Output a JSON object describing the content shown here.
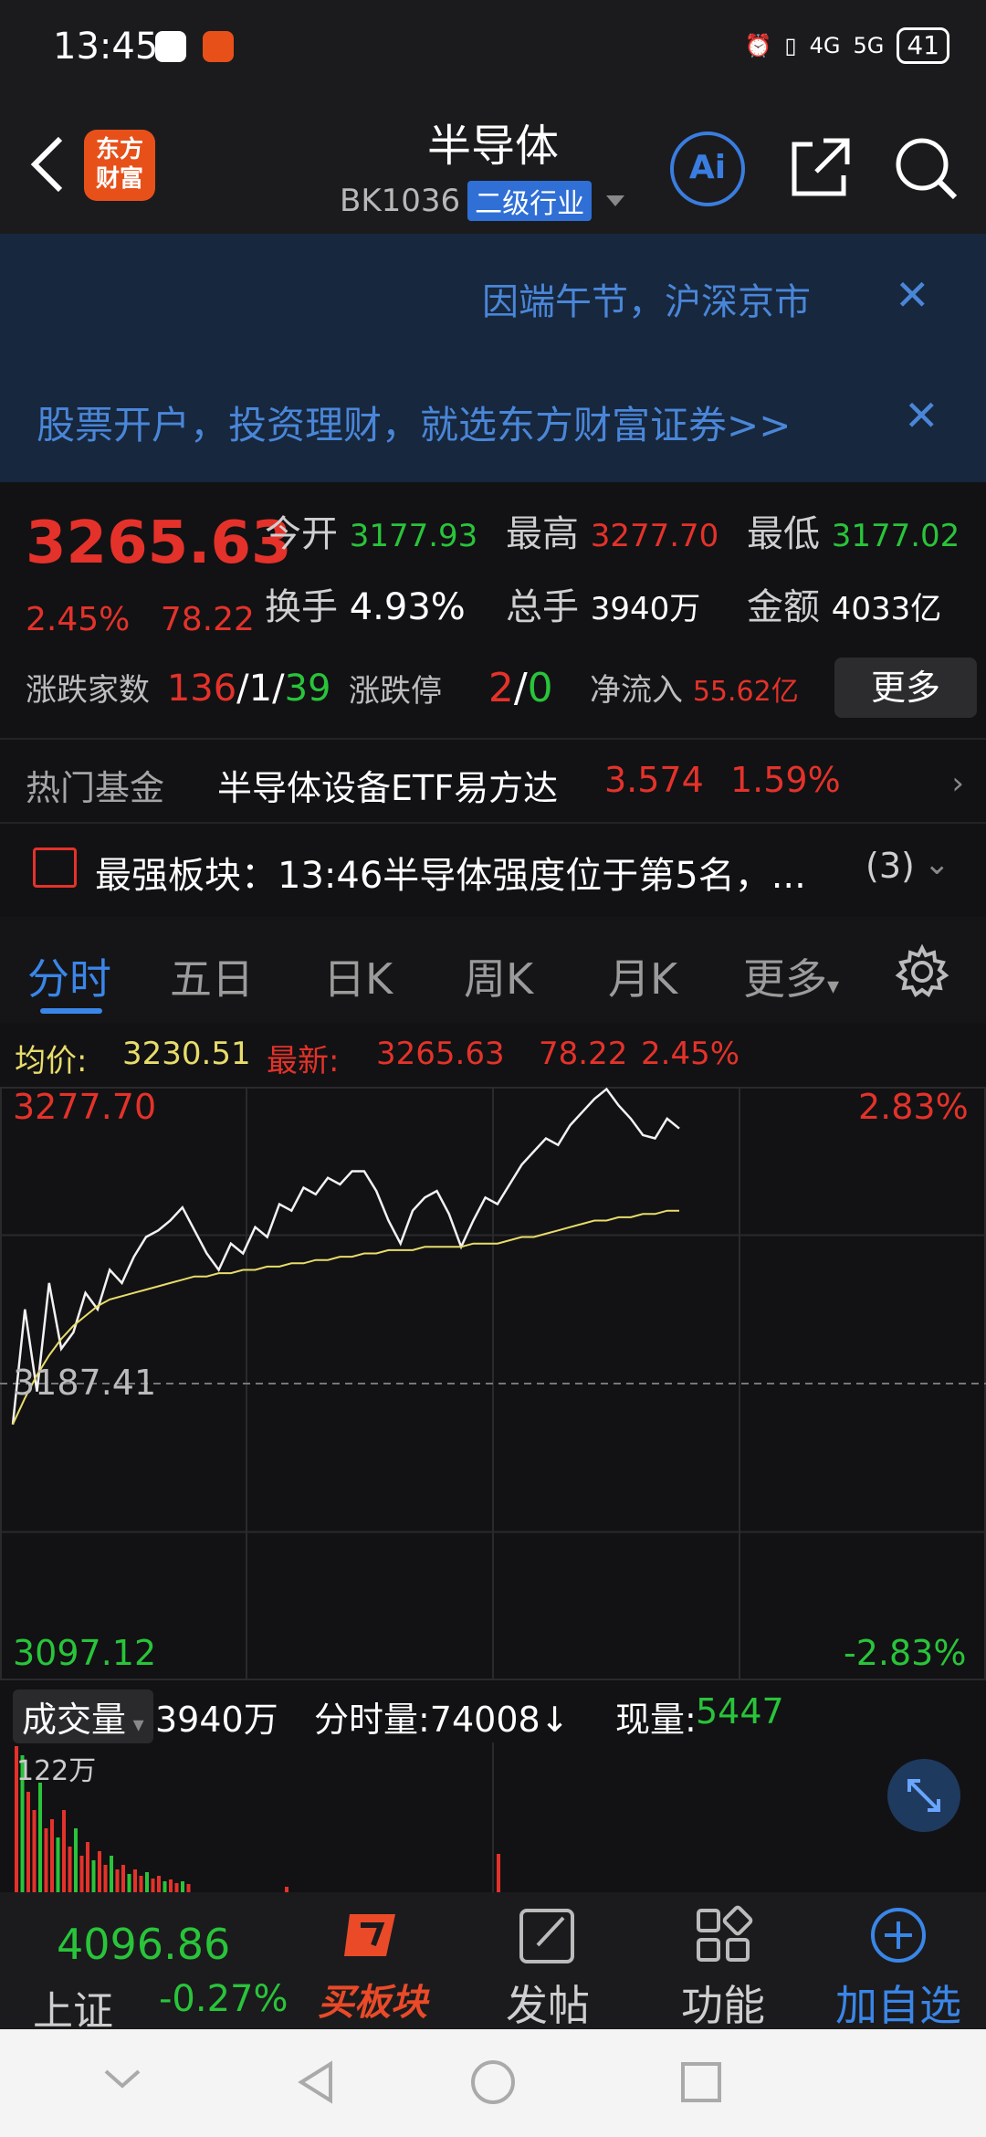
{
  "status": {
    "time": "13:45",
    "signal1": "4G",
    "signal2": "5G",
    "battery": "41"
  },
  "header": {
    "title": "半导体",
    "code": "BK1036",
    "industry_tag": "二级行业",
    "logo_text_1": "东方",
    "logo_text_2": "财富",
    "ai_label": "Ai"
  },
  "notices": {
    "holiday": "因端午节，沪深京市",
    "ad": "股票开户，投资理财，就选东方财富证券>>"
  },
  "quote": {
    "price": "3265.63",
    "change_pct": "2.45%",
    "change_abs": "78.22",
    "open_label": "今开",
    "open": "3177.93",
    "high_label": "最高",
    "high": "3277.70",
    "low_label": "最低",
    "low": "3177.02",
    "turnover_label": "换手",
    "turnover": "4.93%",
    "volume_label": "总手",
    "volume": "3940万",
    "amount_label": "金额",
    "amount": "4033亿",
    "breadth_label": "涨跌家数",
    "up": "136",
    "flat": "1",
    "down": "39",
    "limit_label": "涨跌停",
    "limit_up": "2",
    "limit_down": "0",
    "inflow_label": "净流入",
    "inflow": "55.62亿",
    "more": "更多"
  },
  "fund": {
    "label": "热门基金",
    "name": "半导体设备ETF易方达",
    "price": "3.574",
    "pct": "1.59%"
  },
  "strong": {
    "text": "最强板块：13:46半导体强度位于第5名，...",
    "count": "(3)"
  },
  "tabs": [
    "分时",
    "五日",
    "日K",
    "周K",
    "月K",
    "更多"
  ],
  "avg": {
    "avg_label": "均价:",
    "avg_value": "3230.51",
    "latest_label": "最新:",
    "latest_value": "3265.63",
    "latest_abs": "78.22",
    "latest_pct": "2.45%"
  },
  "chart_data": {
    "type": "line",
    "title": "",
    "y_top": "3277.70",
    "y_mid": "3187.41",
    "y_bottom": "3097.12",
    "pct_top": "2.83%",
    "pct_bottom": "-2.83%",
    "ylim": [
      3097.12,
      3277.7
    ],
    "prev_close": 3187.41,
    "series": [
      {
        "values": [
          3175,
          3210,
          3185,
          3218,
          3198,
          3203,
          3215,
          3210,
          3222,
          3218,
          3226,
          3232,
          3234,
          3237,
          3241,
          3234,
          3227,
          3222,
          3230,
          3227,
          3235,
          3232,
          3242,
          3240,
          3247,
          3245,
          3250,
          3248,
          3252,
          3252,
          3246,
          3237,
          3230,
          3240,
          3244,
          3246,
          3239,
          3229,
          3237,
          3244,
          3242,
          3248,
          3254,
          3258,
          3262,
          3260,
          3266,
          3270,
          3274,
          3277,
          3272,
          3268,
          3263,
          3262,
          3268,
          3265
        ]
      },
      {
        "values": [
          3175,
          3183,
          3190,
          3196,
          3201,
          3205,
          3208,
          3211,
          3213,
          3214,
          3215,
          3216,
          3217,
          3218,
          3219,
          3220,
          3220,
          3221,
          3221,
          3222,
          3222,
          3223,
          3223,
          3224,
          3224,
          3225,
          3225,
          3226,
          3226,
          3227,
          3227,
          3228,
          3228,
          3228,
          3229,
          3229,
          3229,
          3229,
          3230,
          3230,
          3230,
          3231,
          3232,
          3232,
          3233,
          3234,
          3235,
          3236,
          3237,
          3237,
          3238,
          3238,
          3239,
          3239,
          3240,
          3240
        ]
      }
    ]
  },
  "volume": {
    "label": "成交量",
    "total": "3940万",
    "tick_label": "分时量:74008↓",
    "current_label": "现量:",
    "current_value": "5447",
    "axis_max": "122万"
  },
  "bottom_nav": {
    "index_value": "4096.86",
    "index_name": "上证",
    "index_pct": "-0.27%",
    "buy": "买板块",
    "post": "发帖",
    "functions": "功能",
    "watch": "加自选"
  },
  "colors": {
    "up": "#e4322a",
    "down": "#29c43a",
    "accent": "#3a86e8",
    "avg_line": "#e8dc6a"
  }
}
